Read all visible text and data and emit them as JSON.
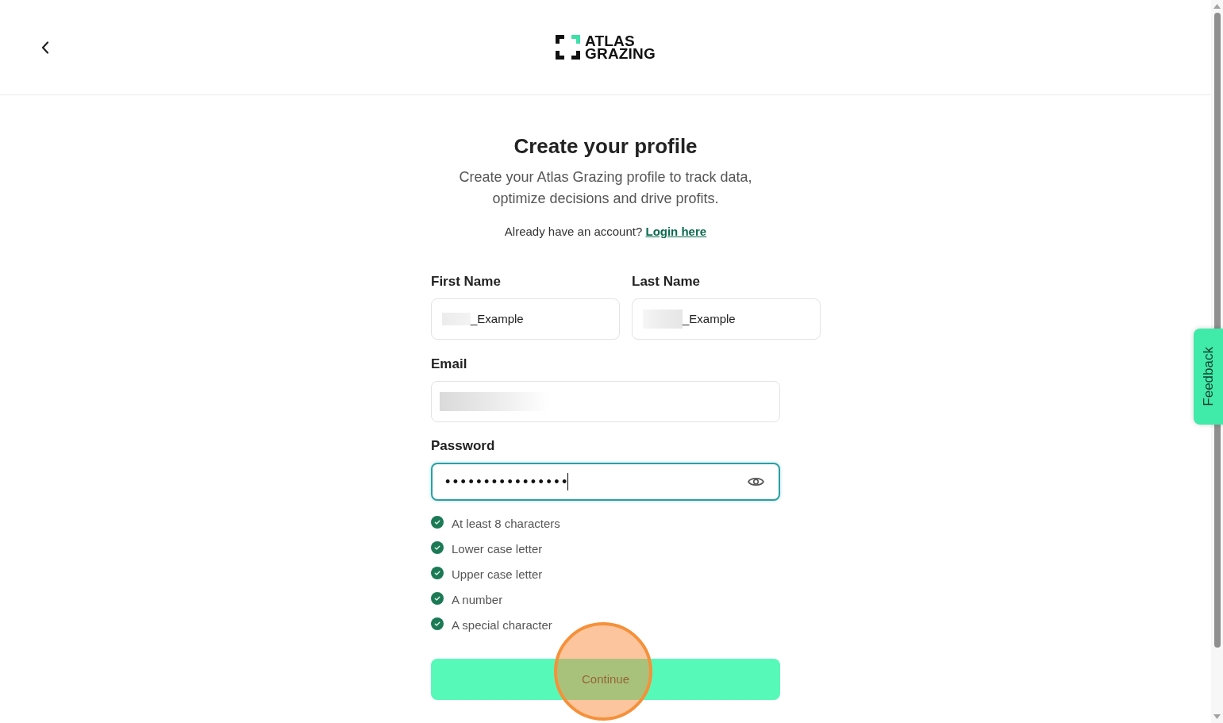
{
  "logo": {
    "lines": [
      "ATLAS",
      "GRAZING"
    ]
  },
  "title": "Create your profile",
  "subtitle": "Create your Atlas Grazing profile to track data, optimize decisions and drive profits.",
  "login_prompt": {
    "text": "Already have an account?",
    "link": "Login here"
  },
  "form": {
    "first_name": {
      "label": "First Name",
      "value": "_Example",
      "redacted": true
    },
    "last_name": {
      "label": "Last Name",
      "value": "_Example",
      "redacted": true
    },
    "email": {
      "label": "Email",
      "redacted": true
    },
    "password": {
      "label": "Password",
      "value": "••••••••••••••••",
      "focused": true
    },
    "requirements": [
      {
        "label": "At least 8 characters",
        "met": true
      },
      {
        "label": "Lower case letter",
        "met": true
      },
      {
        "label": "Upper case letter",
        "met": true
      },
      {
        "label": "A number",
        "met": true
      },
      {
        "label": "A special character",
        "met": true
      }
    ],
    "continue_button": {
      "label": "Continue",
      "highlighted": true
    }
  },
  "feedback_tab": {
    "label": "Feedback"
  }
}
